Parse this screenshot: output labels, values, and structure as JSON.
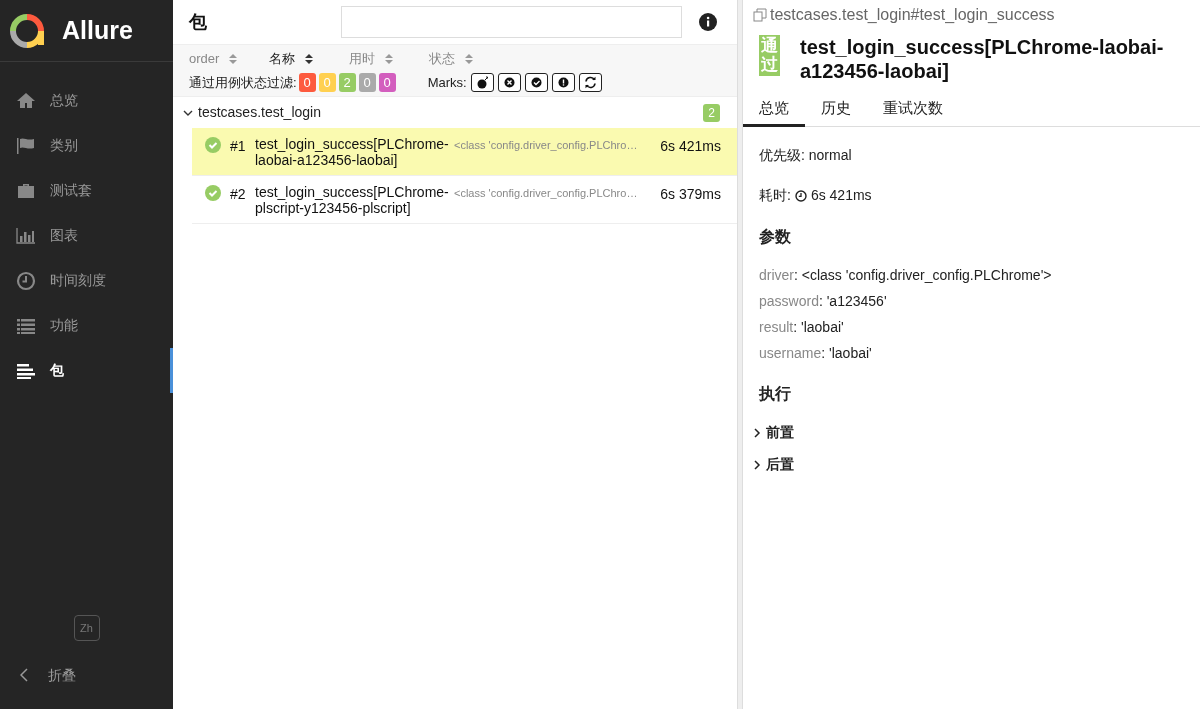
{
  "sidebar": {
    "logo": "Allure",
    "items": [
      {
        "label": "总览",
        "kind": "home",
        "selected": false
      },
      {
        "label": "类别",
        "kind": "flag",
        "selected": false
      },
      {
        "label": "测试套",
        "kind": "briefcase",
        "selected": false
      },
      {
        "label": "图表",
        "kind": "chart",
        "selected": false
      },
      {
        "label": "时间刻度",
        "kind": "clock",
        "selected": false
      },
      {
        "label": "功能",
        "kind": "list",
        "selected": false
      },
      {
        "label": "包",
        "kind": "align",
        "selected": true
      }
    ],
    "language": "Zh",
    "collapse": "折叠"
  },
  "tree": {
    "title": "包",
    "sorters": [
      {
        "label": "order",
        "active": false
      },
      {
        "label": "名称",
        "active": true
      },
      {
        "label": "用时",
        "active": false
      },
      {
        "label": "状态",
        "active": false
      }
    ],
    "filter_label": "通过用例状态过滤:",
    "filters": [
      {
        "value": "0",
        "color": "#fd5a3e"
      },
      {
        "value": "0",
        "color": "#ffd050"
      },
      {
        "value": "2",
        "color": "#97cc64"
      },
      {
        "value": "0",
        "color": "#aaaaaa"
      },
      {
        "value": "0",
        "color": "#d35ebe"
      }
    ],
    "marks_label": "Marks:",
    "marks": [
      {
        "kind": "flaky"
      },
      {
        "kind": "new-failed"
      },
      {
        "kind": "new-passed"
      },
      {
        "kind": "new-broken"
      },
      {
        "kind": "retries"
      }
    ],
    "group": {
      "name": "testcases.test_login",
      "count": "2",
      "expanded": true,
      "rows": [
        {
          "number": "#1",
          "name": "test_login_success[PLChrome-laobai-a123456-laobai]",
          "param": "<class 'config.driver_config.PLChro…",
          "duration": "6s 421ms",
          "selected": true,
          "kind": "passed"
        },
        {
          "number": "#2",
          "name": "test_login_success[PLChrome-plscript-y123456-plscript]",
          "param": "<class 'config.driver_config.PLChro…",
          "duration": "6s 379ms",
          "selected": false,
          "kind": "passed"
        }
      ]
    }
  },
  "detail": {
    "path": "testcases.test_login#test_login_success",
    "status_label": "通过",
    "title": "test_login_success[PLChrome-laobai-a123456-laobai]",
    "tabs": [
      {
        "label": "总览",
        "selected": true
      },
      {
        "label": "历史",
        "selected": false
      },
      {
        "label": "重试次数",
        "selected": false
      }
    ],
    "priority": {
      "label": "优先级:",
      "value": "normal"
    },
    "duration": {
      "label": "耗时:",
      "value": "6s 421ms"
    },
    "params_heading": "参数",
    "params": [
      {
        "name": "driver",
        "value": ": <class 'config.driver_config.PLChrome'>"
      },
      {
        "name": "password",
        "value": ": 'a123456'"
      },
      {
        "name": "result",
        "value": ": 'laobai'"
      },
      {
        "name": "username",
        "value": ": 'laobai'"
      }
    ],
    "execution_heading": "执行",
    "sections": [
      {
        "label": "前置",
        "expanded": false
      },
      {
        "label": "后置",
        "expanded": false
      }
    ]
  }
}
